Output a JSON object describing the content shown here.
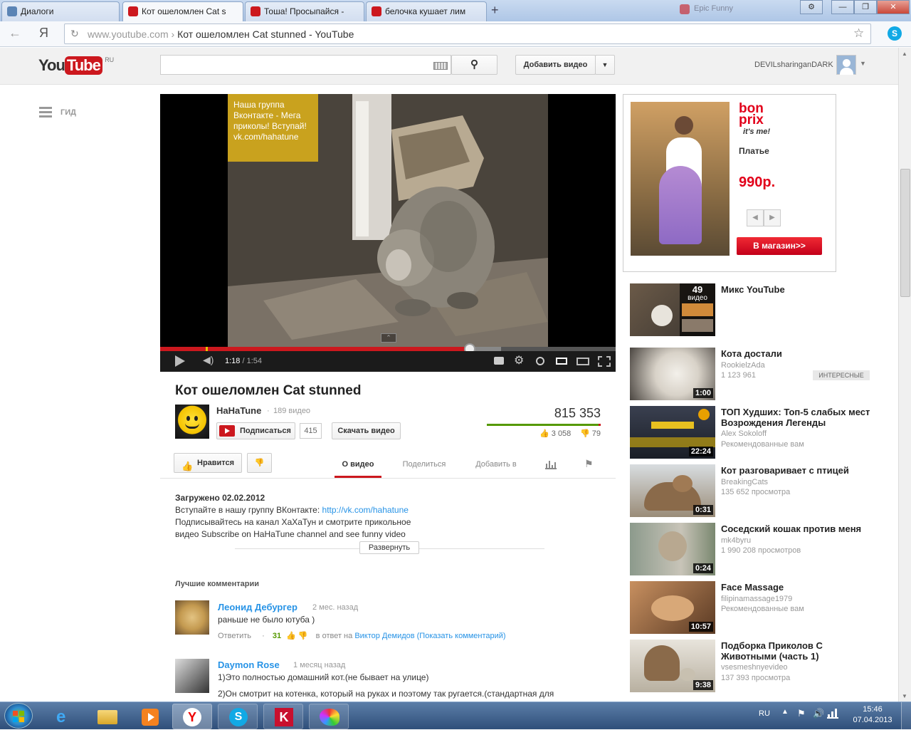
{
  "browser": {
    "tabs": [
      {
        "label": "Диалоги",
        "active": false
      },
      {
        "label": "Кот ошеломлен Cat s",
        "active": true
      },
      {
        "label": "Тоша! Просыпайся -",
        "active": false
      },
      {
        "label": "белочка кушает лим",
        "active": false
      }
    ],
    "ghost_tab": "Epic Funny",
    "url_domain": "www.youtube.com",
    "url_sep": "›",
    "url_title": "Кот ошеломлен Cat stunned - YouTube",
    "yandex_glyph": "Я"
  },
  "header": {
    "logo_you": "You",
    "logo_tube": "Tube",
    "region": "RU",
    "search_value": "",
    "upload_label": "Добавить видео",
    "username": "DEVILsharinganDARK"
  },
  "guide": {
    "label": "ГИД"
  },
  "player": {
    "overlay_text": "Наша группа Вконтакте - Мега приколы! Вступай! vk.com/hahatune",
    "time_current": "1:18",
    "time_sep": " / ",
    "time_total": "1:54",
    "progress_fraction": 0.68
  },
  "video": {
    "title": "Кот ошеломлен Cat stunned",
    "channel": "HaHaTune",
    "channel_sep": "·",
    "channel_videos": "189 видео",
    "subscribe_label": "Подписаться",
    "subscribers": "415",
    "download_label": "Скачать видео",
    "views": "815 353",
    "likes": "3 058",
    "dislikes": "79",
    "like_label": "Нравится"
  },
  "action_tabs": [
    {
      "label": "О видео",
      "active": true
    },
    {
      "label": "Поделиться",
      "active": false
    },
    {
      "label": "Добавить в",
      "active": false
    }
  ],
  "description": {
    "uploaded": "Загружено 02.02.2012",
    "line1_prefix": "Вступайте в нашу группу ВКонтакте: ",
    "line1_link": "http://vk.com/hahatune",
    "line2": "Подписывайтесь на канал ХаХаТун и смотрите прикольное",
    "line3": "видео Subscribe on HaHaTune channel and see funny video",
    "expand_label": "Развернуть"
  },
  "comments": {
    "heading": "Лучшие комментарии",
    "items": [
      {
        "author": "Леонид Дебургер",
        "when": "2 мес. назад",
        "text": "раньше не было ютуба )",
        "reply": "Ответить",
        "reply_sep": "·",
        "votes": "31",
        "in_reply_prefix": "в ответ на",
        "in_reply_link": "Виктор Демидов (Показать комментарий)"
      },
      {
        "author": "Daymon Rose",
        "when": "1 месяц назад",
        "text1": "1)Это полностью домашний кот.(не бывает на улице)",
        "text2": "2)Он смотрит на котенка, который на руках и поэтому так ругается.(стандартная для"
      }
    ]
  },
  "ad": {
    "brand_line1": "bon",
    "brand_line2": "prix",
    "brand_tag": "it's me!",
    "product": "Платье",
    "price": "990р.",
    "shop_button": "В магазин>>"
  },
  "related": [
    {
      "title": "Микс YouTube",
      "line1": "",
      "line2": "",
      "duration": "",
      "badge": "",
      "count": "49",
      "count_label": "видео"
    },
    {
      "title": "Кота достали",
      "line1": "RookielzAda",
      "line2": "1 123 961",
      "duration": "1:00",
      "badge": "ИНТЕРЕСНЫЕ",
      "count": "",
      "count_label": ""
    },
    {
      "title": "ТОП Худших: Топ-5 слабых мест Возрождения Легенды",
      "line1": "Alex Sokoloff",
      "line2": "Рекомендованные вам",
      "duration": "22:24",
      "badge": "",
      "count": "",
      "count_label": ""
    },
    {
      "title": "Кот разговаривает с птицей",
      "line1": "BreakingCats",
      "line2": "135 652 просмотра",
      "duration": "0:31",
      "badge": "",
      "count": "",
      "count_label": ""
    },
    {
      "title": "Соседский кошак против меня",
      "line1": "mk4byru",
      "line2": "1 990 208 просмотров",
      "duration": "0:24",
      "badge": "",
      "count": "",
      "count_label": ""
    },
    {
      "title": "Face Massage",
      "line1": "filipinamassage1979",
      "line2": "Рекомендованные вам",
      "duration": "10:57",
      "badge": "",
      "count": "",
      "count_label": ""
    },
    {
      "title": "Подборка Приколов С Животными (часть 1)",
      "line1": "vsesmeshnyevideo",
      "line2": "137 393 просмотра",
      "duration": "9:38",
      "badge": "",
      "count": "",
      "count_label": ""
    }
  ],
  "taskbar": {
    "lang": "RU",
    "time": "15:46",
    "date": "07.04.2013"
  },
  "colors": {
    "yt_red": "#cc181e",
    "link_blue": "#2793e6",
    "ad_red": "#e2001a",
    "overlay_gold": "#c9a21e"
  }
}
